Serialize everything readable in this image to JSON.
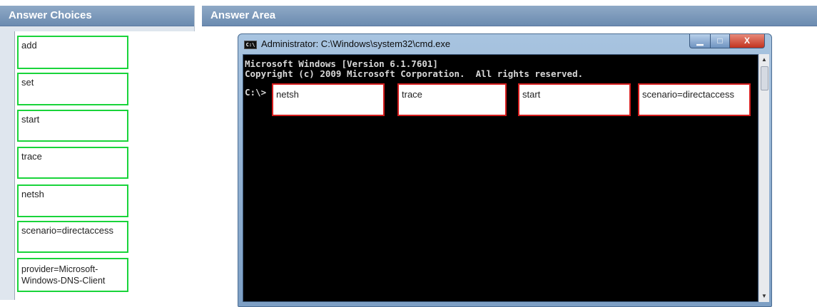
{
  "panels": {
    "left_title": "Answer Choices",
    "right_title": "Answer Area"
  },
  "choices": [
    {
      "label": "add"
    },
    {
      "label": "set"
    },
    {
      "label": "start"
    },
    {
      "label": "trace"
    },
    {
      "label": "netsh"
    },
    {
      "label": "scenario=directaccess"
    },
    {
      "label": "provider=Microsoft-Windows-DNS-Client"
    }
  ],
  "cmd_window": {
    "title": "Administrator: C:\\Windows\\system32\\cmd.exe",
    "line1": "Microsoft Windows [Version 6.1.7601]",
    "line2": "Copyright (c) 2009 Microsoft Corporation.  All rights reserved.",
    "prompt": "C:\\>",
    "slots": [
      {
        "label": "netsh"
      },
      {
        "label": "trace"
      },
      {
        "label": "start"
      },
      {
        "label": "scenario=directaccess"
      }
    ],
    "buttons": {
      "minimize": "▁",
      "maximize": "□",
      "close": "X"
    }
  },
  "colors": {
    "choice_border": "#19d43a",
    "slot_border": "#d51d1d",
    "header": "#7a97b9"
  }
}
